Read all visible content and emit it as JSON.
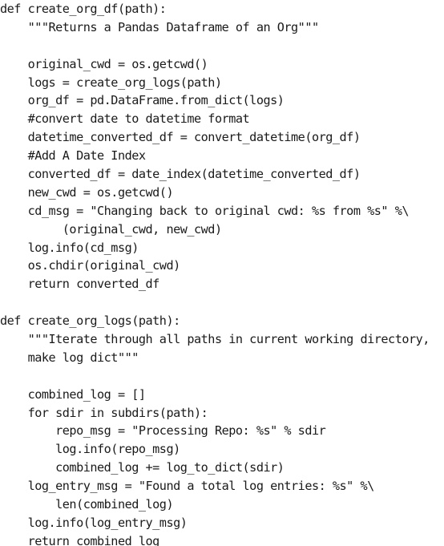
{
  "document": {
    "lines": [
      "def create_org_df(path):",
      "    \"\"\"Returns a Pandas Dataframe of an Org\"\"\"",
      "",
      "    original_cwd = os.getcwd()",
      "    logs = create_org_logs(path)",
      "    org_df = pd.DataFrame.from_dict(logs)",
      "    #convert date to datetime format",
      "    datetime_converted_df = convert_datetime(org_df)",
      "    #Add A Date Index",
      "    converted_df = date_index(datetime_converted_df)",
      "    new_cwd = os.getcwd()",
      "    cd_msg = \"Changing back to original cwd: %s from %s\" %\\",
      "         (original_cwd, new_cwd)",
      "    log.info(cd_msg)",
      "    os.chdir(original_cwd)",
      "    return converted_df",
      "",
      "def create_org_logs(path):",
      "    \"\"\"Iterate through all paths in current working directory,",
      "    make log dict\"\"\"",
      "",
      "    combined_log = []",
      "    for sdir in subdirs(path):",
      "        repo_msg = \"Processing Repo: %s\" % sdir",
      "        log.info(repo_msg)",
      "        combined_log += log_to_dict(sdir)",
      "    log_entry_msg = \"Found a total log entries: %s\" %\\",
      "        len(combined_log)",
      "    log.info(log_entry_msg)",
      "    return combined_log"
    ]
  }
}
